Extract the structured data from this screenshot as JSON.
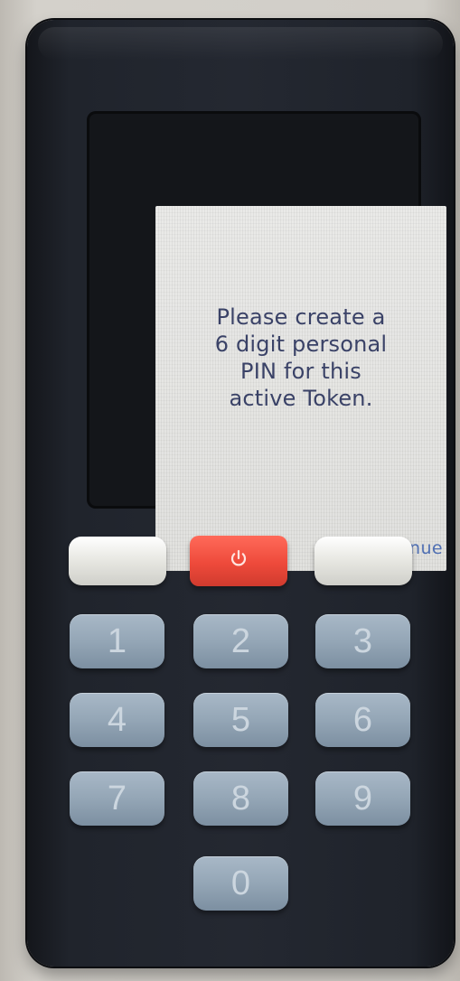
{
  "screen": {
    "message_lines": [
      "Please create a",
      "6 digit personal",
      "PIN for this",
      "active Token."
    ],
    "softkey_right_label": "Continue"
  },
  "keypad": {
    "power_icon": "power-icon",
    "keys": [
      "1",
      "2",
      "3",
      "4",
      "5",
      "6",
      "7",
      "8",
      "9",
      "0"
    ]
  },
  "colors": {
    "device_body": "#23272f",
    "screen_bg": "#e5e5e3",
    "screen_text": "#3a4267",
    "continue_text": "#4f6fb3",
    "power_button": "#e8473a",
    "softkeys": "#ebebe6",
    "number_keys": "#8fa2b3"
  }
}
